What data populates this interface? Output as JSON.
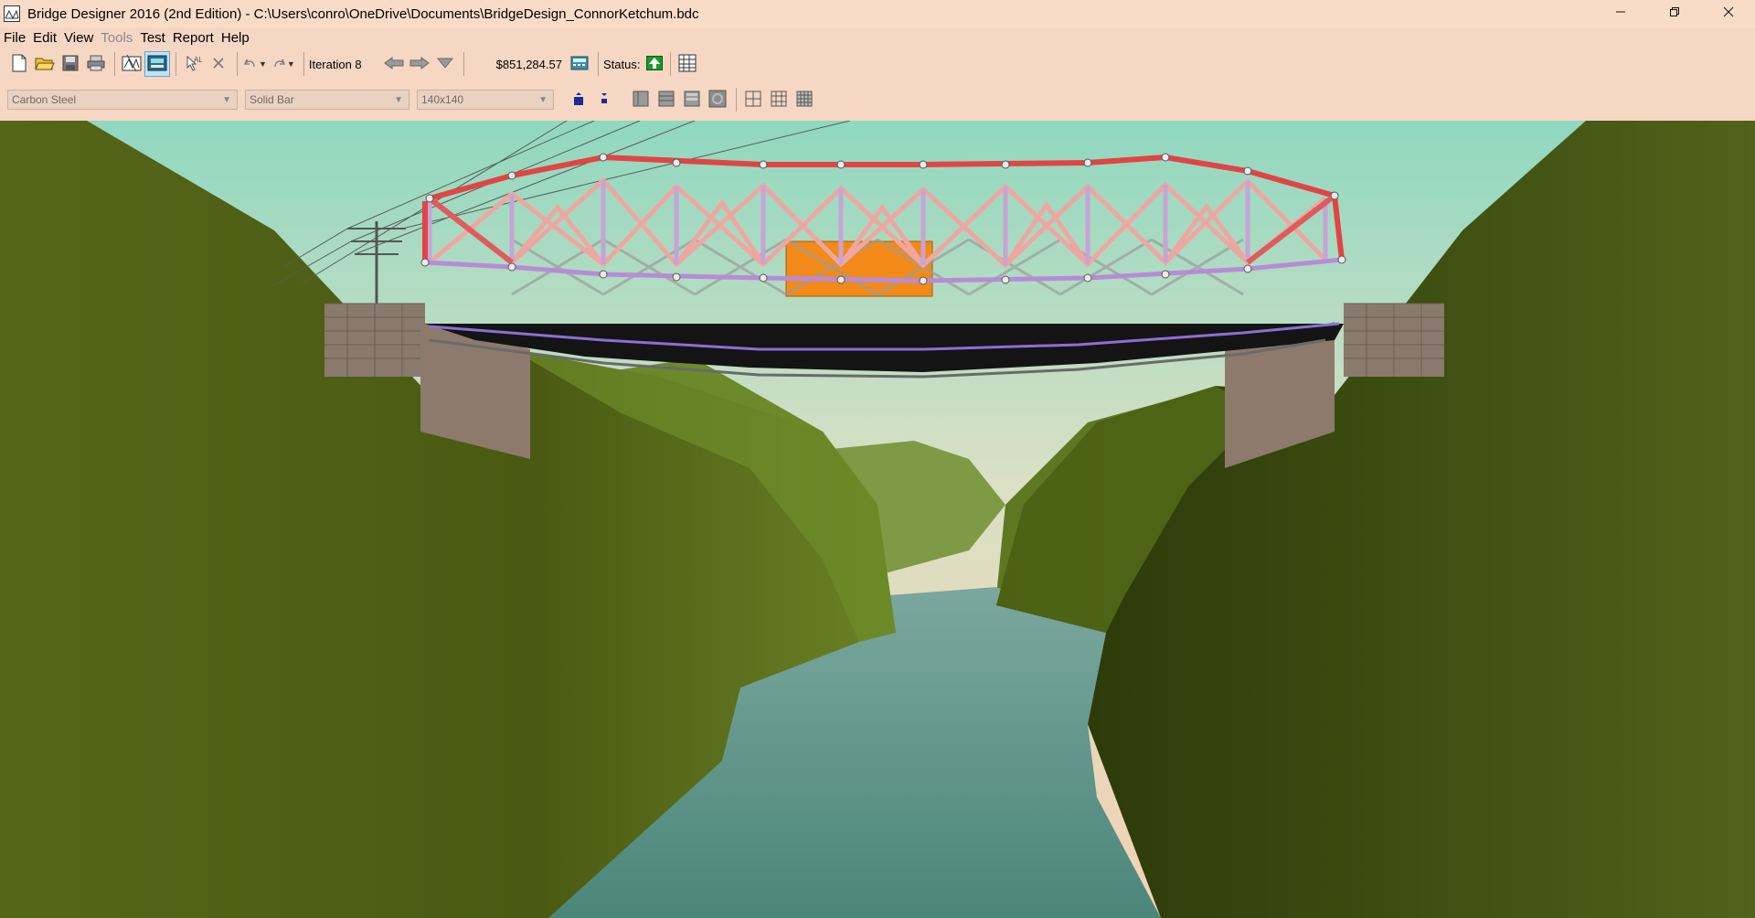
{
  "window": {
    "title": "Bridge Designer 2016 (2nd Edition) - C:\\Users\\conro\\OneDrive\\Documents\\BridgeDesign_ConnorKetchum.bdc",
    "controls": [
      "minimize",
      "restore",
      "close"
    ]
  },
  "menu": {
    "items": [
      {
        "label": "File",
        "enabled": true
      },
      {
        "label": "Edit",
        "enabled": true
      },
      {
        "label": "View",
        "enabled": true
      },
      {
        "label": "Tools",
        "enabled": false
      },
      {
        "label": "Test",
        "enabled": true
      },
      {
        "label": "Report",
        "enabled": true
      },
      {
        "label": "Help",
        "enabled": true
      }
    ]
  },
  "toolbar": {
    "iteration_label": "Iteration 8",
    "cost": "$851,284.57",
    "status_label": "Status:",
    "status_icon": "green-up-arrow-icon",
    "status_color": "#1a9a2a",
    "load_test_active": true
  },
  "toolbar2": {
    "material": "Carbon Steel",
    "section": "Solid Bar",
    "size": "140x140"
  },
  "scene": {
    "sky_top": "#8fd8c0",
    "sky_bottom": "#f2d2b4",
    "hill_color": "#4a5e14",
    "water_color": "#4d8a82",
    "truss_tension_color": "#e06060",
    "truss_compression_color": "#c9a3d6",
    "truck_color": "#f28a1a"
  }
}
